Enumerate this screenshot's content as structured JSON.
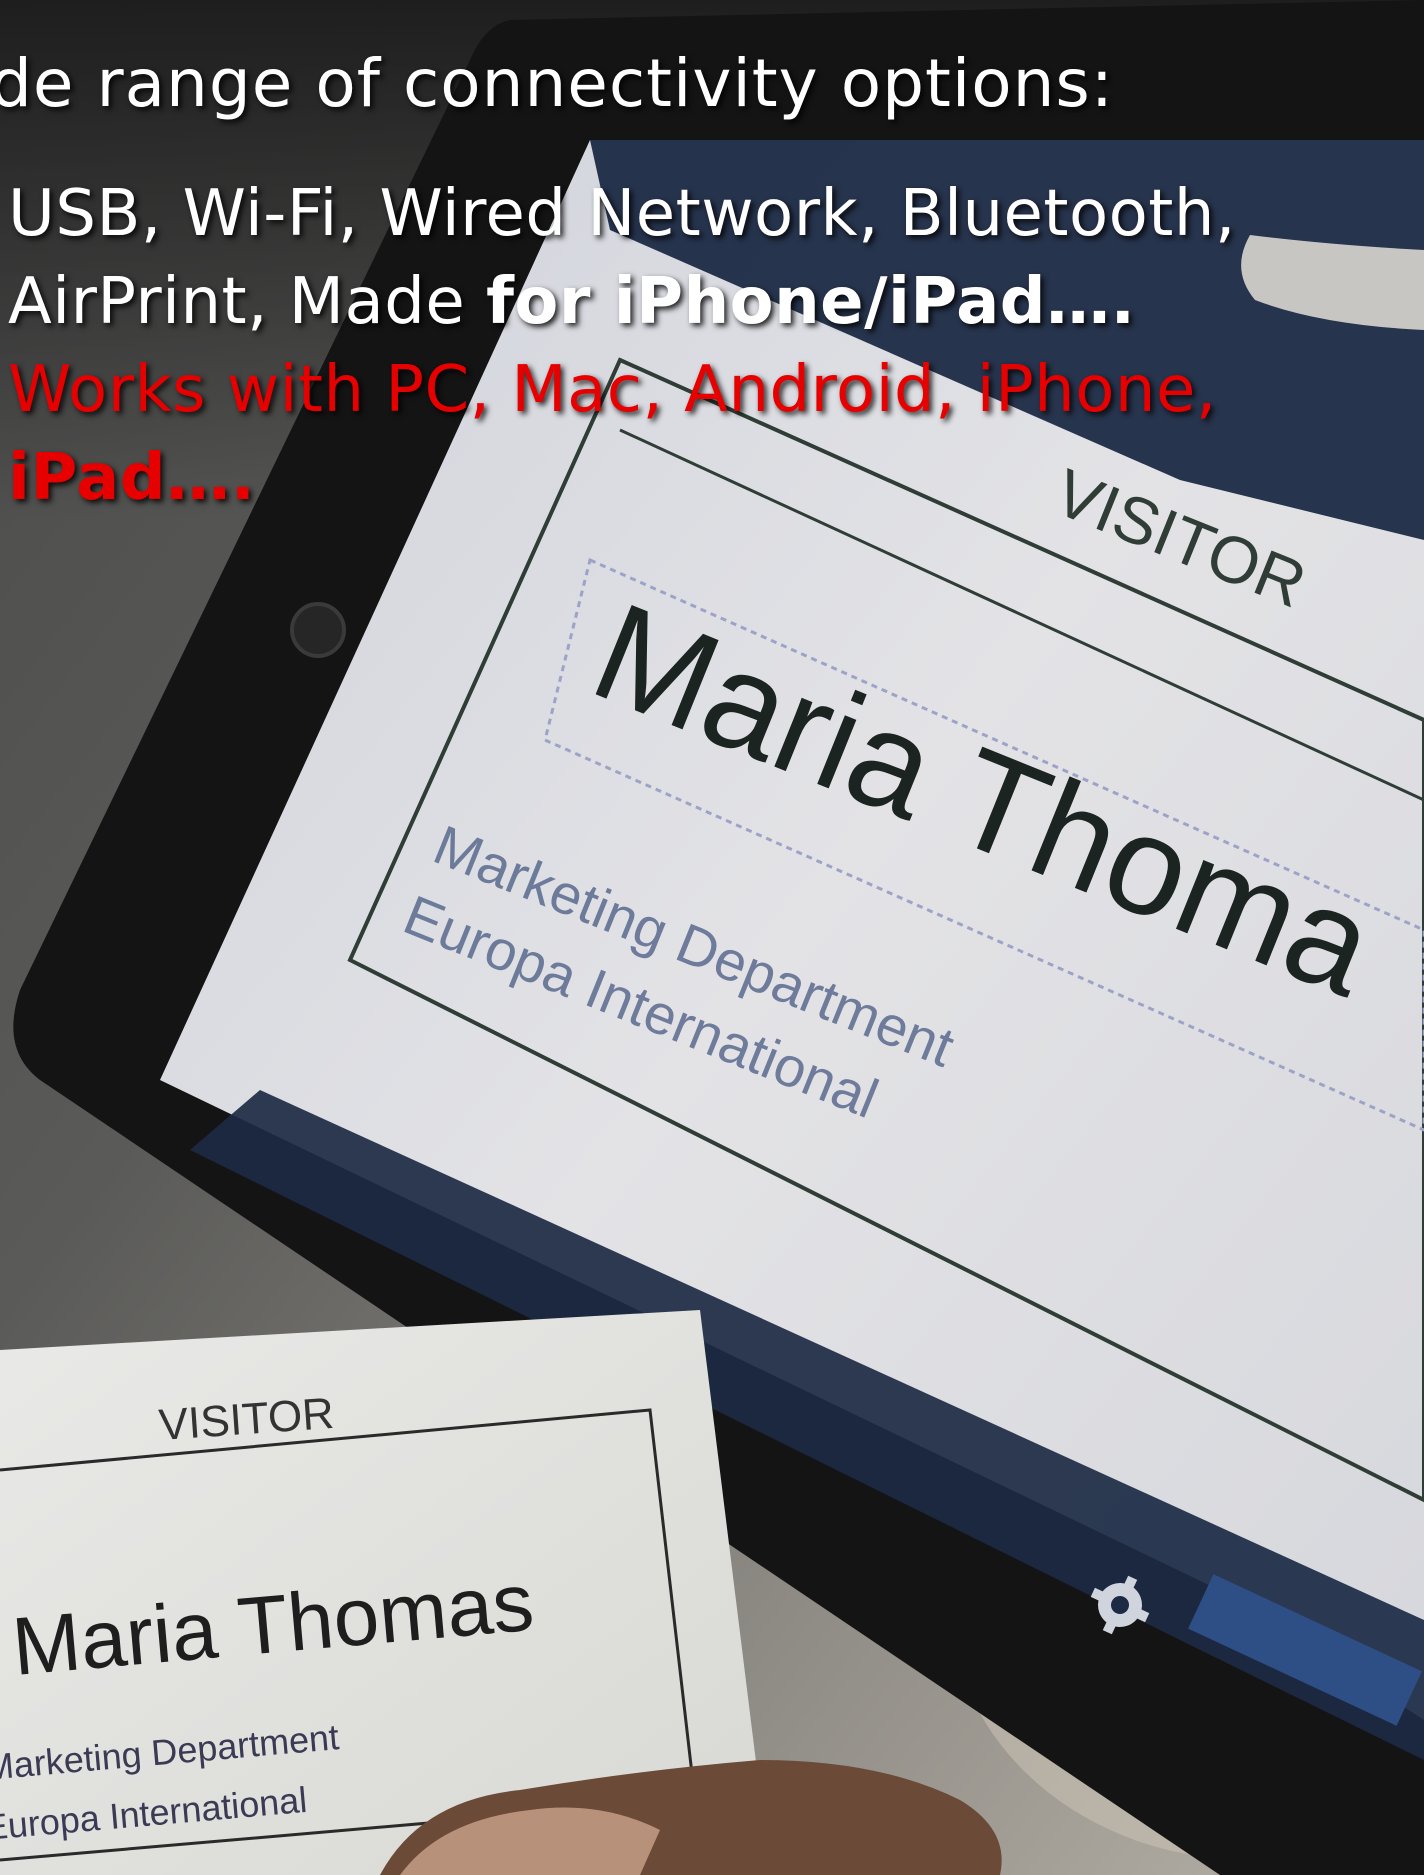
{
  "headline": "de range of connectivity options:",
  "lines": {
    "l1": "USB, Wi-Fi, Wired Network, Bluetooth,",
    "l2_normal": "AirPrint, Made ",
    "l2_bold": "for iPhone/iPad….",
    "l3": "Works with PC, Mac, Android, iPhone,",
    "l4": "iPad…."
  },
  "tablet_badge": {
    "header": "VISITOR",
    "name": "Maria Thoma",
    "department": "Marketing Department",
    "company": "Europa International"
  },
  "printed_badge": {
    "header": "VISITOR",
    "name": "Maria Thomas",
    "department": "Marketing Department",
    "company": "Europa International"
  },
  "colors": {
    "highlight_red": "#e60000",
    "overlay_text": "#ffffff",
    "tablet_frame": "#141414",
    "tablet_bar": "#1c2a44",
    "screen": "#dcdde2"
  }
}
